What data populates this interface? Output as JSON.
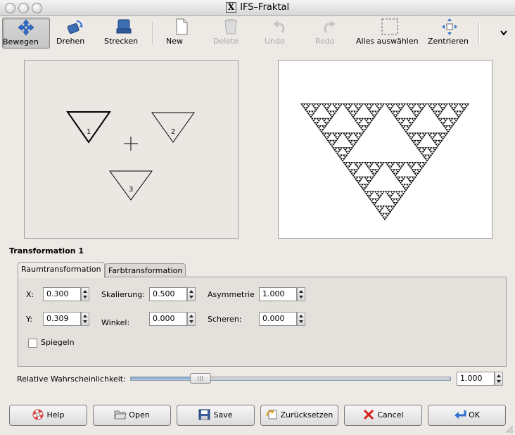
{
  "window": {
    "title": "IFS–Fraktal",
    "title_glyph": "X"
  },
  "toolbar": {
    "items": [
      {
        "label": "Bewegen",
        "icon": "move-arrows-icon",
        "state": "active"
      },
      {
        "label": "Drehen",
        "icon": "rotate-icon",
        "state": "normal"
      },
      {
        "label": "Strecken",
        "icon": "stretch-icon",
        "state": "normal"
      },
      {
        "label": "New",
        "icon": "new-document-icon",
        "state": "normal"
      },
      {
        "label": "Delete",
        "icon": "trash-icon",
        "state": "disabled"
      },
      {
        "label": "Undo",
        "icon": "undo-icon",
        "state": "disabled"
      },
      {
        "label": "Redo",
        "icon": "redo-icon",
        "state": "disabled"
      },
      {
        "label": "Alles auswählen",
        "icon": "select-all-icon",
        "state": "normal"
      },
      {
        "label": "Zentrieren",
        "icon": "center-icon",
        "state": "normal"
      }
    ],
    "overflow_icon": "chevron-down-icon"
  },
  "canvas": {
    "transform_labels": [
      "1",
      "2",
      "3"
    ]
  },
  "transformation": {
    "title": "Transformation 1",
    "tabs": [
      "Raumtransformation",
      "Farbtransformation"
    ],
    "selected_tab": "Raumtransformation",
    "fields": {
      "x": {
        "label": "X:",
        "value": "0.300"
      },
      "y": {
        "label": "Y:",
        "value": "0.309"
      },
      "skalierung": {
        "label": "Skalierung:",
        "value": "0.500"
      },
      "winkel": {
        "label": "Winkel:",
        "value": "0.000"
      },
      "asymmetrie": {
        "label": "Asymmetrie",
        "value": "1.000"
      },
      "scheren": {
        "label": "Scheren:",
        "value": "0.000"
      }
    },
    "spiegeln": {
      "label": "Spiegeln",
      "checked": false
    }
  },
  "probability": {
    "label": "Relative Wahrscheinlichkeit:",
    "value": "1.000",
    "slider_fraction": 0.2
  },
  "buttons": [
    {
      "id": "help",
      "label": "Help",
      "icon": "lifebuoy-icon"
    },
    {
      "id": "open",
      "label": "Open",
      "icon": "folder-icon"
    },
    {
      "id": "save",
      "label": "Save",
      "icon": "floppy-icon"
    },
    {
      "id": "reset",
      "label": "Zurücksetzen",
      "icon": "reset-icon"
    },
    {
      "id": "cancel",
      "label": "Cancel",
      "icon": "cancel-icon"
    },
    {
      "id": "ok",
      "label": "OK",
      "icon": "ok-arrow-icon"
    }
  ],
  "colors": {
    "accent": "#3a7bd5",
    "window_bg": "#edeae6",
    "slider_fill": "#7da0c4",
    "cancel_red": "#d62020",
    "ok_blue": "#2f6fd0"
  }
}
